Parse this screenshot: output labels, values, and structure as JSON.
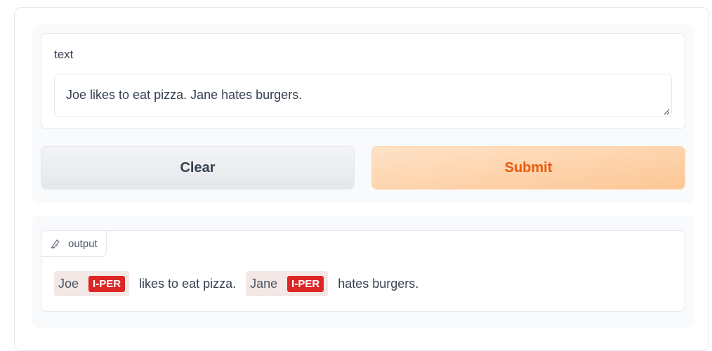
{
  "input": {
    "label": "text",
    "value": "Joe likes to eat pizza. Jane hates burgers."
  },
  "buttons": {
    "clear_label": "Clear",
    "submit_label": "Submit"
  },
  "output": {
    "label": "output",
    "icon": "highlight-icon",
    "segments": [
      {
        "text": "Joe",
        "entity": "I-PER"
      },
      {
        "text": "likes to eat pizza.",
        "entity": null
      },
      {
        "text": "Jane",
        "entity": "I-PER"
      },
      {
        "text": "hates burgers.",
        "entity": null
      }
    ]
  },
  "colors": {
    "entity_label": "#dc2626",
    "entity_bg": "#f3e8e5",
    "submit_text": "#ea580c"
  }
}
